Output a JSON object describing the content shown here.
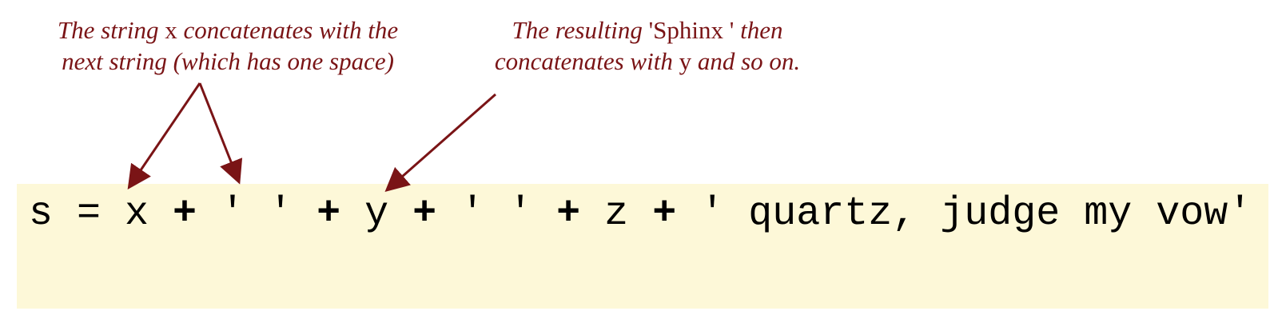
{
  "annotation_left": {
    "line1_a": "The string ",
    "line1_code": "x",
    "line1_b": " concatenates with the",
    "line2": "next string (which has one space)"
  },
  "annotation_right": {
    "line1_a": "The resulting ",
    "line1_code": "'Sphinx '",
    "line1_b": " then",
    "line2_a": "concatenates with ",
    "line2_code": "y",
    "line2_b": " and so on."
  },
  "code": {
    "tokens": [
      {
        "text": "s = x ",
        "bold": false
      },
      {
        "text": "+",
        "bold": true
      },
      {
        "text": " ' ' ",
        "bold": false
      },
      {
        "text": "+",
        "bold": true
      },
      {
        "text": " y ",
        "bold": false
      },
      {
        "text": "+",
        "bold": true
      },
      {
        "text": " ' ' ",
        "bold": false
      },
      {
        "text": "+",
        "bold": true
      },
      {
        "text": " z ",
        "bold": false
      },
      {
        "text": "+",
        "bold": true
      },
      {
        "text": " ' quartz, judge my vow'",
        "bold": false
      }
    ]
  },
  "colors": {
    "annotation": "#7a1416",
    "arrow": "#7a1416",
    "code_background": "#fdf8d8",
    "code_text": "#000000"
  }
}
